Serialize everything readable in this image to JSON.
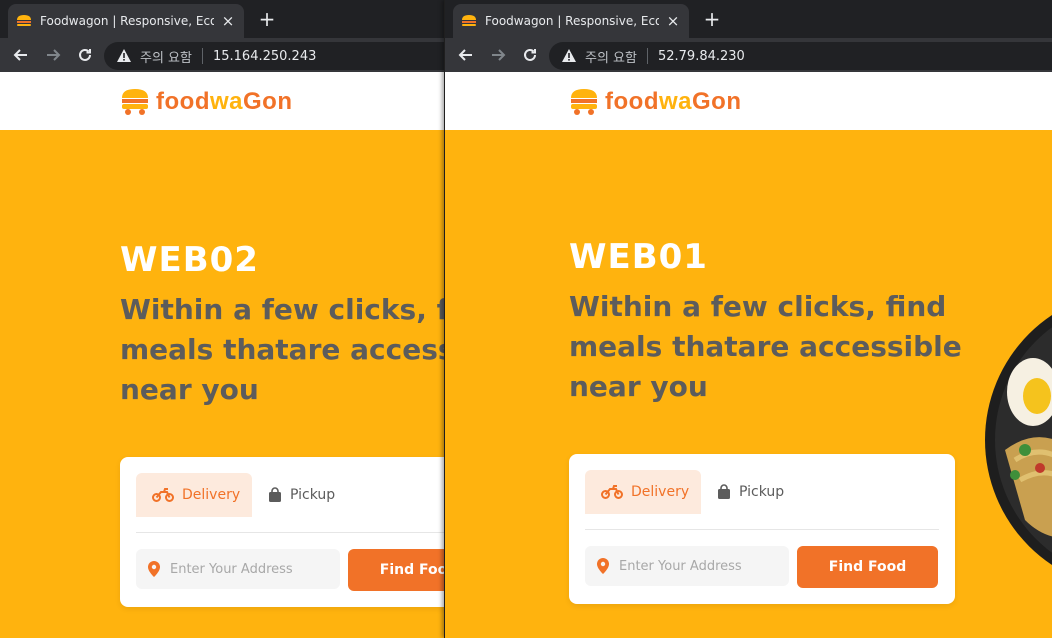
{
  "left_window": {
    "tab_title": "Foodwagon | Responsive, Ecommerce",
    "tab_close": "×",
    "new_tab": "+",
    "security_warning": "주의 요함",
    "url": "15.164.250.243",
    "logo": {
      "part1": "food",
      "part2": "wa",
      "part3": "Gon"
    },
    "hero_title": "WEB02",
    "hero_subtitle": "Within a few clicks, find\nmeals thatare accessible\nnear you",
    "search": {
      "delivery_label": "Delivery",
      "pickup_label": "Pickup",
      "address_placeholder": "Enter Your Address",
      "find_button": "Find Food"
    }
  },
  "right_window": {
    "tab_title": "Foodwagon | Responsive, Ecommerce",
    "tab_close": "×",
    "new_tab": "+",
    "security_warning": "주의 요함",
    "url": "52.79.84.230",
    "logo": {
      "part1": "food",
      "part2": "wa",
      "part3": "Gon"
    },
    "hero_title": "WEB01",
    "hero_subtitle": "Within a few clicks, find\nmeals thatare accessible\nnear you",
    "search": {
      "delivery_label": "Delivery",
      "pickup_label": "Pickup",
      "address_placeholder": "Enter Your Address",
      "find_button": "Find Food"
    }
  },
  "colors": {
    "brand_orange": "#f17228",
    "brand_yellow": "#ffb30e",
    "subtitle_gray": "#5c5c5c",
    "delivery_tab_bg": "#fdeadd"
  },
  "icons": [
    "back-arrow-icon",
    "forward-arrow-icon",
    "reload-icon",
    "warning-icon",
    "motorbike-icon",
    "shopping-bag-icon",
    "location-pin-icon",
    "burger-logo-icon",
    "close-icon",
    "plus-icon"
  ]
}
